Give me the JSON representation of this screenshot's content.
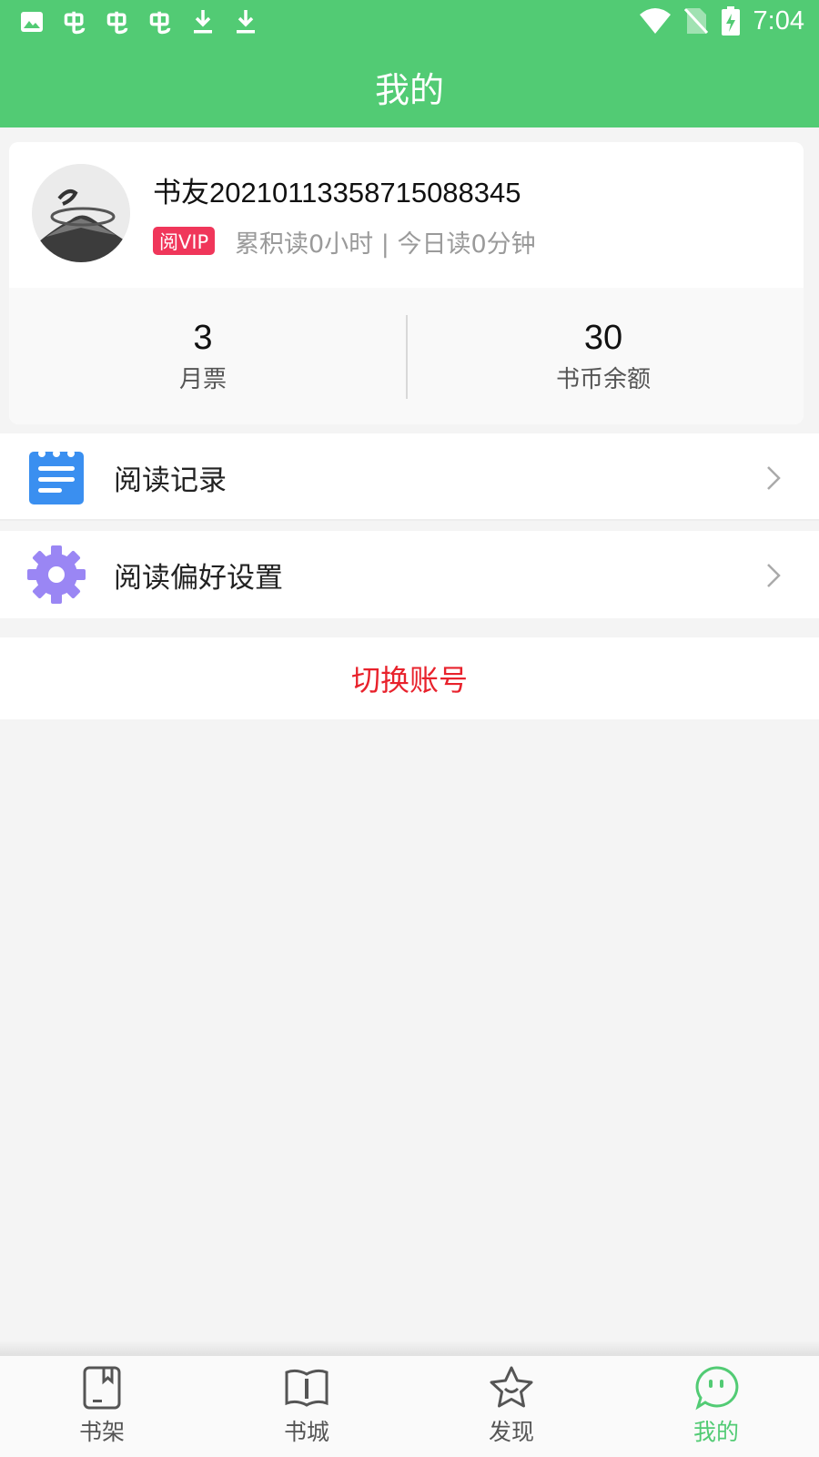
{
  "status_bar": {
    "time": "7:04",
    "left_icons": [
      "image-icon",
      "bug-icon",
      "bug-icon",
      "bug-icon",
      "download-icon",
      "download-icon"
    ],
    "right_icons": [
      "wifi-icon",
      "no-sim-icon",
      "battery-charging-icon"
    ]
  },
  "header": {
    "title": "我的"
  },
  "profile": {
    "username": "书友20210113358715088345",
    "vip_badge": "阅VIP",
    "reading_stats": "累积读0小时 | 今日读0分钟",
    "stats": [
      {
        "value": "3",
        "label": "月票"
      },
      {
        "value": "30",
        "label": "书币余额"
      }
    ]
  },
  "menu": {
    "items": [
      {
        "label": "阅读记录",
        "icon": "document-list-icon"
      },
      {
        "label": "阅读偏好设置",
        "icon": "gear-icon"
      }
    ]
  },
  "switch_account": {
    "label": "切换账号"
  },
  "bottom_nav": {
    "items": [
      {
        "label": "书架",
        "icon": "bookshelf-icon"
      },
      {
        "label": "书城",
        "icon": "book-open-icon"
      },
      {
        "label": "发现",
        "icon": "star-icon"
      },
      {
        "label": "我的",
        "icon": "chat-bubble-icon",
        "active": true
      }
    ]
  },
  "colors": {
    "brand_green": "#52cb74",
    "vip_pink": "#f0365a",
    "danger_red": "#e8222c",
    "icon_blue": "#3a8ff0",
    "icon_purple": "#9a86f4"
  }
}
